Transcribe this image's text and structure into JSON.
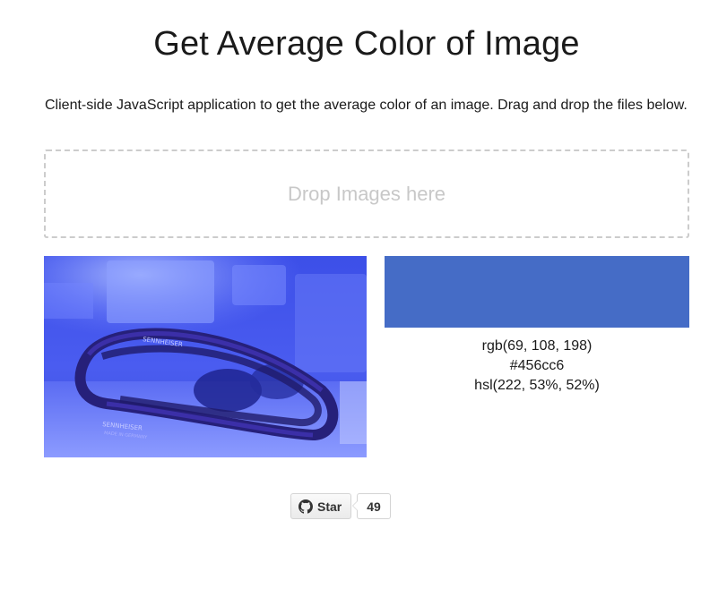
{
  "page": {
    "title": "Get Average Color of Image",
    "description": "Client-side JavaScript application to get the average color of an image. Drag and drop the files below."
  },
  "dropzone": {
    "label": "Drop Images here"
  },
  "result": {
    "image_subject": "blue-tinted photo of headphones",
    "headband_text": "SENNHEISER",
    "headband_subtext": "MADE IN GERMANY",
    "swatch_color": "#456cc6",
    "rgb": "rgb(69, 108, 198)",
    "hex": "#456cc6",
    "hsl": "hsl(222, 53%, 52%)"
  },
  "github": {
    "star_label": "Star",
    "star_count": "49",
    "icon": "github-octocat-icon"
  }
}
